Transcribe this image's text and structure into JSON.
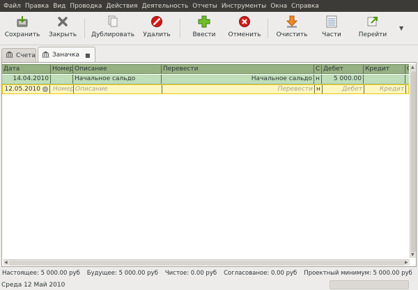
{
  "menubar": {
    "items": [
      "Файл",
      "Правка",
      "Вид",
      "Проводка",
      "Действия",
      "Деятельность",
      "Отчеты",
      "Инструменты",
      "Окна",
      "Справка"
    ]
  },
  "toolbar": {
    "save": "Сохранить",
    "close": "Закрыть",
    "duplicate": "Дублировать",
    "delete": "Удалить",
    "enter": "Ввести",
    "cancel": "Отменить",
    "blank": "Очистить",
    "split": "Части",
    "jump": "Перейти"
  },
  "tabs": [
    {
      "label": "Счета"
    },
    {
      "label": "Заначка"
    }
  ],
  "register": {
    "columns": {
      "date": "Дата",
      "num": "Номер",
      "description": "Описание",
      "transfer": "Перевести",
      "reconcile": "С",
      "debit": "Дебет",
      "credit": "Кредит",
      "balance": "С"
    },
    "rows": [
      {
        "date": "14.04.2010",
        "num": "",
        "description": "Начальное сальдо",
        "transfer": "Начальное сальдо",
        "reconcile": "н",
        "debit": "5 000.00",
        "credit": ""
      }
    ],
    "new_row": {
      "date": "12.05.2010",
      "num_placeholder": "Номер",
      "description_placeholder": "Описание",
      "transfer_placeholder": "Перевести",
      "reconcile": "н",
      "debit_placeholder": "Дебет",
      "credit_placeholder": "Кредит"
    }
  },
  "summary": {
    "present": "Настоящее: 5 000.00 руб",
    "future": "Будущее: 5 000.00 руб",
    "cleared": "Чистое: 0.00 руб",
    "reconciled": "Согласованое: 0.00 руб",
    "projected_min": "Проектный минимум: 5 000.00 руб"
  },
  "statusbar": {
    "text": "Среда 12 Май 2010"
  },
  "colors": {
    "header_green": "#96b183",
    "row_green": "#bfdeb9",
    "cursor_yellow": "#fdf6c0"
  }
}
